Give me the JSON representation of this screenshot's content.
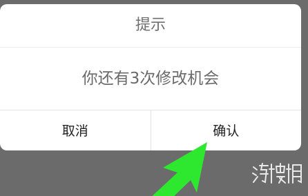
{
  "dialog": {
    "title": "提示",
    "message": "你还有3次修改机会",
    "cancel_label": "取消",
    "confirm_label": "确认"
  },
  "overlay": {
    "arrow_icon": "arrow-up-right-icon",
    "arrow_color": "#2ee830",
    "watermark_text": "游侠网"
  },
  "colors": {
    "backdrop": "#6b6b6b",
    "dialog_bg": "#ffffff",
    "title_text": "#6e6e6e",
    "button_text": "#222222"
  }
}
